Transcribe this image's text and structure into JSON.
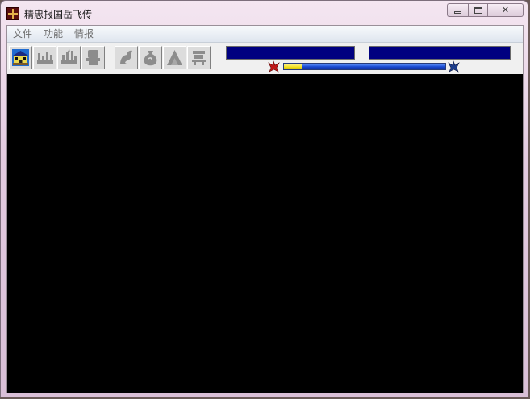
{
  "window": {
    "title": "精忠报国岳飞传",
    "caption": {
      "minimize": "minimize",
      "maximize": "maximize",
      "close": "✕"
    }
  },
  "menu": [
    "文件",
    "功能",
    "情报"
  ],
  "toolbar": {
    "buttons": [
      {
        "icon": "castle-icon",
        "enabled": true
      },
      {
        "icon": "army-icon",
        "enabled": false
      },
      {
        "icon": "march-icon",
        "enabled": false
      },
      {
        "icon": "scroll-icon",
        "enabled": false
      },
      {
        "icon": "dragon-icon",
        "enabled": false
      },
      {
        "icon": "bag-icon",
        "enabled": false
      },
      {
        "icon": "mountain-icon",
        "enabled": false
      },
      {
        "icon": "beast-icon",
        "enabled": false
      }
    ],
    "left_flag_icon": "red-eagle-flag-icon",
    "right_flag_icon": "blue-eagle-flag-icon",
    "balance_progress": 0.11
  },
  "colors": {
    "status_bar": "#000080",
    "progress_fill": "#f3e11f",
    "progress_track": "#1d4fd6",
    "game_area": "#000000"
  }
}
